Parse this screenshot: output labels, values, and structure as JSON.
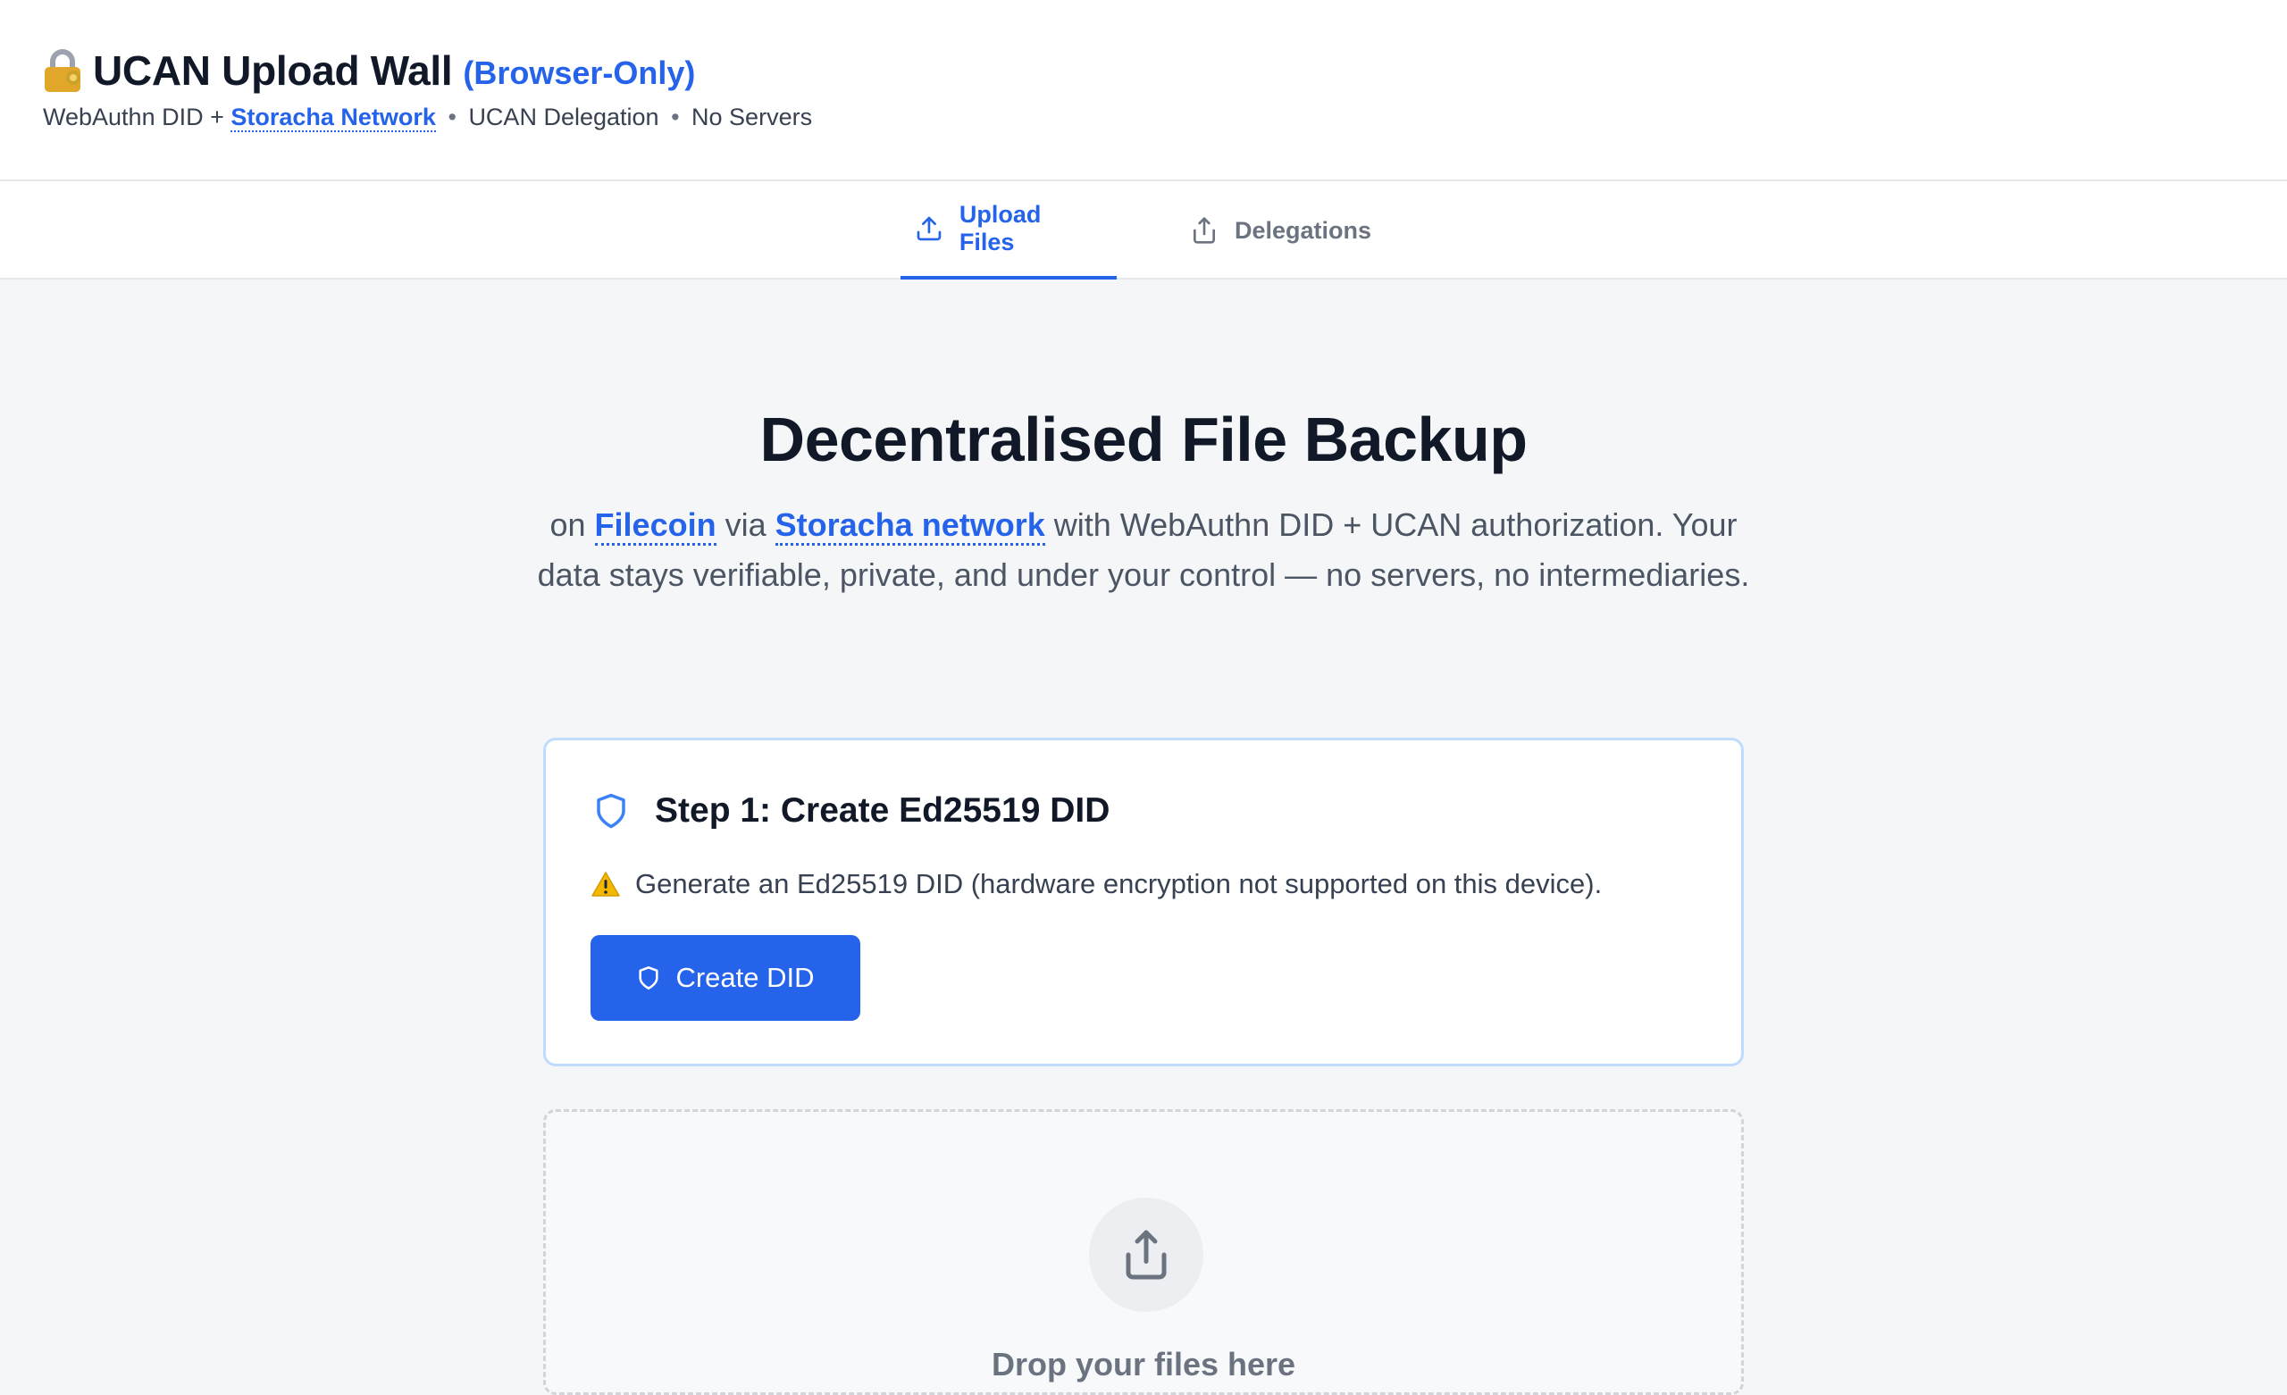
{
  "header": {
    "title": "UCAN Upload Wall",
    "badge": "(Browser-Only)",
    "subtitle_prefix": "WebAuthn DID +",
    "subtitle_link": "Storacha Network",
    "subtitle_item2": "UCAN Delegation",
    "subtitle_item3": "No Servers",
    "separator": "•"
  },
  "tabs": [
    {
      "label": "Upload Files",
      "active": true,
      "icon": "upload-icon"
    },
    {
      "label": "Delegations",
      "active": false,
      "icon": "share-icon"
    }
  ],
  "hero": {
    "title": "Decentralised File Backup",
    "text_on": "on",
    "link_filecoin": "Filecoin",
    "text_via": "via",
    "link_storacha": "Storacha network",
    "text_rest": "with WebAuthn DID + UCAN authorization. Your data stays verifiable, private, and under your control — no servers, no intermediaries."
  },
  "step": {
    "title": "Step 1: Create Ed25519 DID",
    "note": "Generate an Ed25519 DID (hardware encryption not supported on this device).",
    "button_label": "Create DID"
  },
  "dropzone": {
    "text": "Drop your files here"
  },
  "colors": {
    "accent": "#2563eb",
    "card_border": "#bfdbfe",
    "warning": "#f5b800"
  }
}
